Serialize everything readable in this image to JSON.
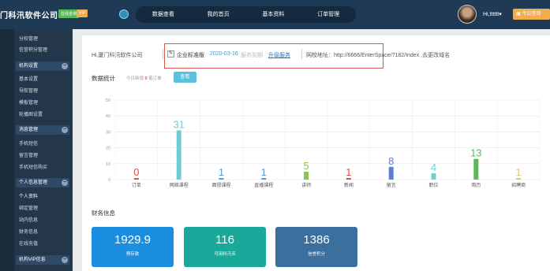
{
  "topbar": {
    "logo": "门科汛软件公司",
    "badge_green": "在线咨询",
    "badge_vip": "VIP",
    "nav": [
      "数据查看",
      "我的首页",
      "基本资料",
      "订单管理"
    ],
    "username": "Hi,tttttt▾",
    "signin": "今日签到"
  },
  "sidebar": {
    "items_top": [
      "分校管理",
      "信誉积分管理"
    ],
    "group1": {
      "title": "机构设置",
      "items": [
        "基本设置",
        "导航管理",
        "模板管理",
        "轮播图设置"
      ]
    },
    "group2": {
      "title": "消息管理",
      "items": [
        "手机短信",
        "留言管理",
        "手机短信购买"
      ]
    },
    "group3": {
      "title": "个人信息管理",
      "items": [
        "个人资料",
        "绑定管理",
        "站内信息",
        "财务信息",
        "在线充值"
      ]
    },
    "group4": {
      "title": "机构VIP信息"
    }
  },
  "info": {
    "company": "Hi,厦门科汛软件公司",
    "version_name": "企业标准版",
    "version_date": "2020-03-16",
    "version_expire": "服务到期",
    "upgrade": "升级服务",
    "url": "网校地址：http://6666/EnterSpace/?182/Index ,去更改域名"
  },
  "stats": {
    "title": "数据统计",
    "sub_prefix": "今日新增",
    "sub_num": "0",
    "sub_suffix": "笔订单",
    "query": "查看"
  },
  "chart_data": {
    "type": "bar",
    "categories": [
      "订单",
      "网络课程",
      "面授课程",
      "直播课程",
      "讲师",
      "新闻",
      "留言",
      "职位",
      "简历",
      "招聘商"
    ],
    "values": [
      0,
      31,
      1,
      1,
      5,
      1,
      8,
      4,
      13,
      1
    ],
    "colors": [
      "#d9534f",
      "#6fcfd0",
      "#5b9bd5",
      "#5b9bd5",
      "#8ac44d",
      "#d9534f",
      "#5b7fd5",
      "#6fcfd0",
      "#5cb85c",
      "#e2c85c"
    ],
    "ylim": [
      0,
      50
    ],
    "yticks": [
      "0",
      "10",
      "20",
      "30",
      "40",
      "50"
    ]
  },
  "finance": {
    "title": "财务信息",
    "cards": [
      {
        "value": "1929.9",
        "label": "预存款",
        "color": "#1b8ee0"
      },
      {
        "value": "116",
        "label": "可用科汛币",
        "color": "#1aa89a"
      },
      {
        "value": "1386",
        "label": "信誉积分",
        "color": "#3a6f9e"
      }
    ]
  }
}
